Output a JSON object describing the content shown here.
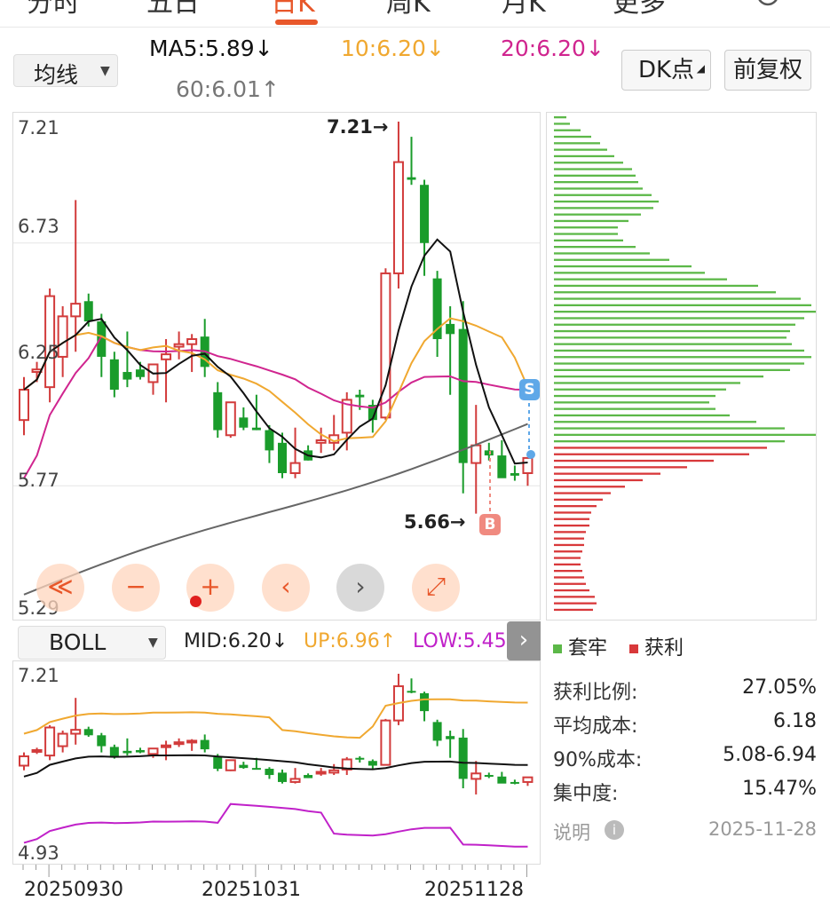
{
  "tabs": {
    "items": [
      "分时",
      "五日",
      "日K",
      "周K",
      "月K",
      "更多"
    ],
    "active_index": 2,
    "accent": "#e8572a"
  },
  "ma_panel": {
    "indicator": "均线",
    "ma5": "MA5:5.89",
    "ma10": "10:6.20",
    "ma20": "20:6.20",
    "ma60": "60:6.01",
    "ma5_arrow": "↓",
    "ma10_arrow": "↓",
    "ma20_arrow": "↓",
    "ma60_arrow": "↑",
    "dk_button": "DK点",
    "adjust_button": "前复权",
    "y_labels": [
      "7.21",
      "6.73",
      "6.25",
      "5.77",
      "5.29"
    ],
    "high_annotation": "7.21→",
    "low_annotation": "5.66→",
    "buy_marker": "B",
    "sell_marker": "S",
    "controls": [
      "≪",
      "−",
      "+",
      "‹",
      "›",
      "⤢"
    ]
  },
  "boll_panel": {
    "indicator": "BOLL",
    "mid": "MID:6.20",
    "up": "UP:6.96",
    "low": "LOW:5.45",
    "mid_arrow": "↓",
    "up_arrow": "↑",
    "y_labels": [
      "7.21",
      "4.93"
    ],
    "x_labels": [
      "20250930",
      "20251031",
      "20251128"
    ]
  },
  "chip_info": {
    "legend_trapped": "套牢",
    "legend_profit": "获利",
    "rows": [
      {
        "label": "获利比例:",
        "value": "27.05%"
      },
      {
        "label": "平均成本:",
        "value": "6.18"
      },
      {
        "label": "90%成本:",
        "value": "5.08-6.94"
      },
      {
        "label": "集中度:",
        "value": "15.47%"
      }
    ],
    "note_label": "说明",
    "date": "2025-11-28"
  },
  "colors": {
    "up": "#d23b3b",
    "down": "#1a9c2b",
    "ma5": "#111111",
    "ma10": "#f0a830",
    "ma20": "#d0258f",
    "ma60": "#666666",
    "boll_up": "#f0a830",
    "boll_mid": "#111111",
    "boll_low": "#c021c9",
    "chip_trapped": "#5cb848",
    "chip_profit": "#d8383a"
  },
  "chart_data": {
    "type": "candlestick",
    "price_range": [
      5.29,
      7.21
    ],
    "candles": [
      {
        "o": 6.03,
        "h": 6.2,
        "l": 5.97,
        "c": 6.15
      },
      {
        "o": 6.22,
        "h": 6.26,
        "l": 6.18,
        "c": 6.23
      },
      {
        "o": 6.16,
        "h": 6.55,
        "l": 6.1,
        "c": 6.52
      },
      {
        "o": 6.28,
        "h": 6.48,
        "l": 6.2,
        "c": 6.44
      },
      {
        "o": 6.44,
        "h": 6.9,
        "l": 6.3,
        "c": 6.49
      },
      {
        "o": 6.5,
        "h": 6.53,
        "l": 6.4,
        "c": 6.42
      },
      {
        "o": 6.42,
        "h": 6.45,
        "l": 6.2,
        "c": 6.28
      },
      {
        "o": 6.27,
        "h": 6.3,
        "l": 6.12,
        "c": 6.15
      },
      {
        "o": 6.22,
        "h": 6.38,
        "l": 6.16,
        "c": 6.19
      },
      {
        "o": 6.23,
        "h": 6.26,
        "l": 6.19,
        "c": 6.2
      },
      {
        "o": 6.18,
        "h": 6.24,
        "l": 6.13,
        "c": 6.25
      },
      {
        "o": 6.27,
        "h": 6.35,
        "l": 6.1,
        "c": 6.29
      },
      {
        "o": 6.32,
        "h": 6.38,
        "l": 6.27,
        "c": 6.33
      },
      {
        "o": 6.33,
        "h": 6.37,
        "l": 6.22,
        "c": 6.35
      },
      {
        "o": 6.36,
        "h": 6.43,
        "l": 6.2,
        "c": 6.24
      },
      {
        "o": 6.14,
        "h": 6.18,
        "l": 5.96,
        "c": 5.99
      },
      {
        "o": 5.97,
        "h": 6.1,
        "l": 5.96,
        "c": 6.1
      },
      {
        "o": 6.04,
        "h": 6.08,
        "l": 5.99,
        "c": 6.0
      },
      {
        "o": 6.0,
        "h": 6.13,
        "l": 5.99,
        "c": 5.99
      },
      {
        "o": 5.99,
        "h": 6.01,
        "l": 5.86,
        "c": 5.91
      },
      {
        "o": 5.94,
        "h": 5.98,
        "l": 5.8,
        "c": 5.82
      },
      {
        "o": 5.82,
        "h": 6.0,
        "l": 5.8,
        "c": 5.86
      },
      {
        "o": 5.91,
        "h": 5.93,
        "l": 5.87,
        "c": 5.87
      },
      {
        "o": 5.94,
        "h": 6.0,
        "l": 5.9,
        "c": 5.95
      },
      {
        "o": 5.94,
        "h": 6.05,
        "l": 5.91,
        "c": 5.97
      },
      {
        "o": 5.98,
        "h": 6.14,
        "l": 5.91,
        "c": 6.11
      },
      {
        "o": 6.13,
        "h": 6.15,
        "l": 6.07,
        "c": 6.12
      },
      {
        "o": 6.09,
        "h": 6.11,
        "l": 5.98,
        "c": 6.03
      },
      {
        "o": 6.04,
        "h": 6.63,
        "l": 6.03,
        "c": 6.61
      },
      {
        "o": 6.61,
        "h": 7.21,
        "l": 6.55,
        "c": 7.05
      },
      {
        "o": 6.99,
        "h": 7.15,
        "l": 6.96,
        "c": 6.98
      },
      {
        "o": 6.96,
        "h": 6.98,
        "l": 6.6,
        "c": 6.73
      },
      {
        "o": 6.59,
        "h": 6.62,
        "l": 6.28,
        "c": 6.35
      },
      {
        "o": 6.41,
        "h": 6.48,
        "l": 6.13,
        "c": 6.37
      },
      {
        "o": 6.39,
        "h": 6.5,
        "l": 5.74,
        "c": 5.86
      },
      {
        "o": 5.86,
        "h": 6.09,
        "l": 5.66,
        "c": 5.93
      },
      {
        "o": 5.91,
        "h": 5.94,
        "l": 5.87,
        "c": 5.89
      },
      {
        "o": 5.89,
        "h": 5.95,
        "l": 5.84,
        "c": 5.8
      },
      {
        "o": 5.82,
        "h": 5.85,
        "l": 5.79,
        "c": 5.81
      },
      {
        "o": 5.82,
        "h": 5.87,
        "l": 5.77,
        "c": 5.88
      }
    ]
  }
}
